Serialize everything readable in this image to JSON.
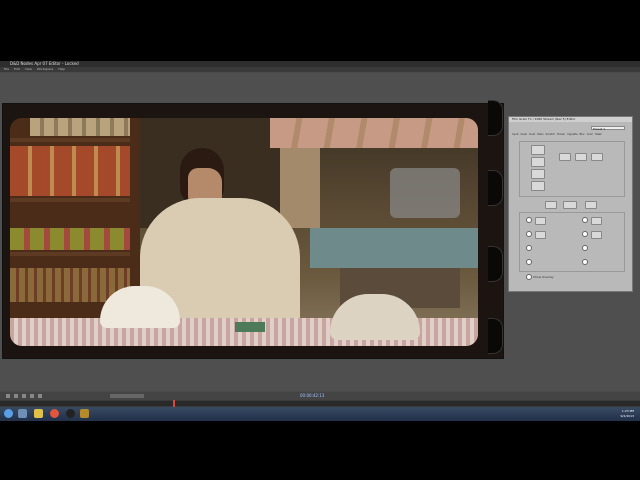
{
  "window": {
    "title": "D&D Nodes Apr 07 Editor - Locked"
  },
  "menu": [
    "File",
    "Edit",
    "View",
    "Workspace",
    "Help"
  ],
  "panel": {
    "title": "Film Grain Fx / 1080 Stream (Rev 5) Editor",
    "tabs": [
      "Input",
      "Grain",
      "Dust",
      "Hairs",
      "Scratch",
      "Flicker",
      "Vignette",
      "Blur",
      "Color",
      "Mask"
    ],
    "preset_field": "Preset 1",
    "checkbox_label": "Show Overlay"
  },
  "timeline": {
    "timecode": "00:00:42:13",
    "progress": 0.27
  },
  "taskbar": {
    "clock_time": "1:23 PM",
    "clock_date": "9/2/2013"
  }
}
